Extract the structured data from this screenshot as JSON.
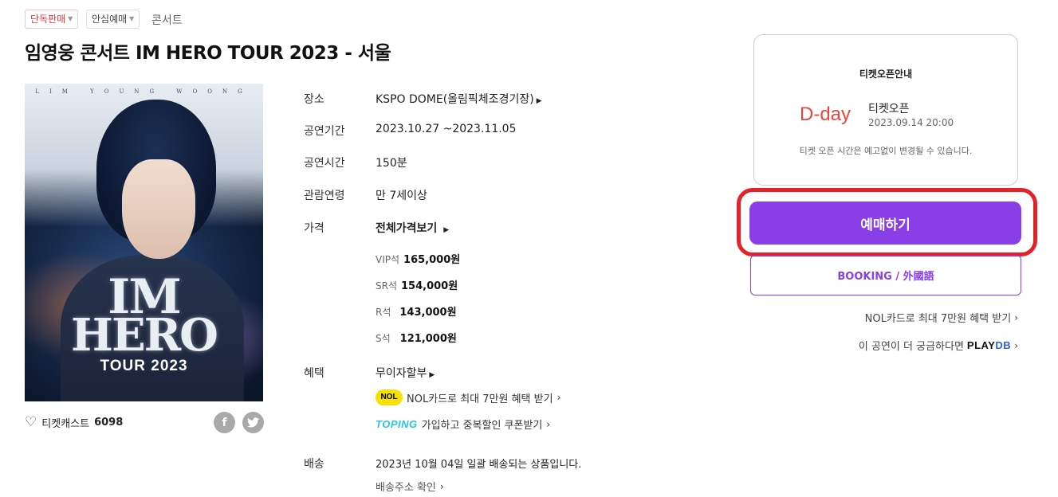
{
  "tags": {
    "exclusive": "단독판매",
    "safe": "안심예매",
    "genre": "콘서트"
  },
  "title": "임영웅 콘서트 IM HERO TOUR 2023 - 서울",
  "poster": {
    "top_text": "LIM YOUNG WOONG",
    "line1": "IM",
    "line2": "HERO",
    "line3": "TOUR 2023"
  },
  "ticketcast": {
    "label": "티켓캐스트",
    "count": "6098"
  },
  "info": {
    "venue_label": "장소",
    "venue": "KSPO DOME(올림픽체조경기장)",
    "period_label": "공연기간",
    "period": "2023.10.27 ~2023.11.05",
    "runtime_label": "공연시간",
    "runtime": "150분",
    "age_label": "관람연령",
    "age": "만 7세이상",
    "price_label": "가격",
    "price_all": "전체가격보기",
    "prices": [
      {
        "seat": "VIP석",
        "amount": "165,000원"
      },
      {
        "seat": "SR석",
        "amount": "154,000원"
      },
      {
        "seat": "R석",
        "amount": "143,000원"
      },
      {
        "seat": "S석",
        "amount": "121,000원"
      }
    ],
    "benefit_label": "혜택",
    "benefit": "무이자할부",
    "nol_logo": "NOL",
    "nol_benefit": "NOL카드로 최대 7만원 혜택 받기",
    "toping_logo": "TOPING",
    "toping_benefit": "가입하고 중복할인 쿠폰받기",
    "delivery_label": "배송",
    "delivery": "2023년 10월 04일 일괄 배송되는 상품입니다.",
    "delivery_check": "배송주소 확인"
  },
  "open_box": {
    "heading": "티켓오픈안내",
    "dday": "D-day",
    "open_label": "티켓오픈",
    "open_date": "2023.09.14 20:00",
    "note": "티켓 오픈 시간은 예고없이 변경될 수 있습니다."
  },
  "buttons": {
    "reserve": "예매하기",
    "booking": "BOOKING / 外國語"
  },
  "links": {
    "nol": "NOL카드로 최대 7만원 혜택 받기",
    "playdb": "이 공연이 더 궁금하다면",
    "playdb_logo_a": "PLAY",
    "playdb_logo_b": "DB"
  },
  "colors": {
    "accent": "#8a3ee8",
    "highlight": "#e4222a",
    "dday": "#e8453c"
  }
}
